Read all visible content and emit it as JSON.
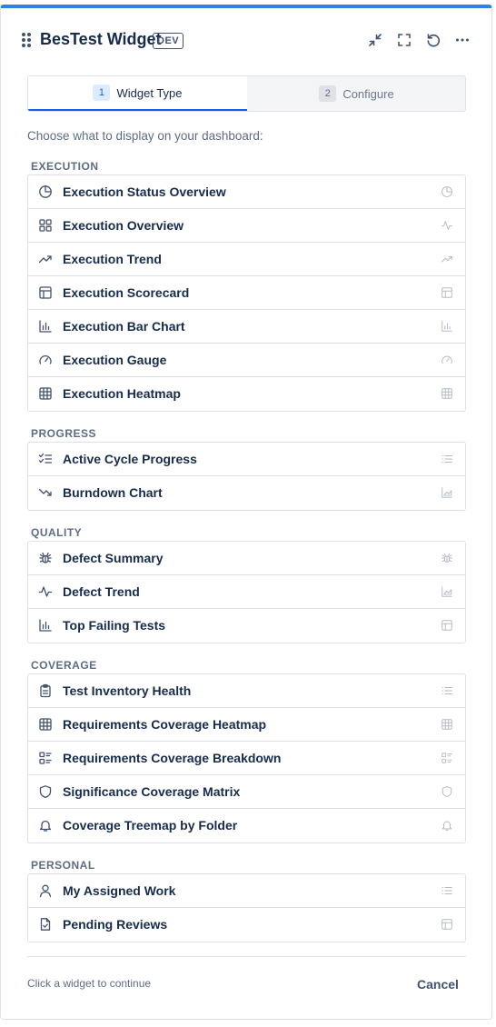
{
  "header": {
    "title": "BesTest Widget",
    "badge": "DEV",
    "actions": [
      "minimize-icon",
      "fullscreen-icon",
      "refresh-icon",
      "more-icon"
    ]
  },
  "stepper": {
    "steps": [
      {
        "number": "1",
        "label": "Widget Type",
        "active": true
      },
      {
        "number": "2",
        "label": "Configure",
        "active": false
      }
    ]
  },
  "intro": "Choose what to display on your dashboard:",
  "sections": [
    {
      "label": "EXECUTION",
      "items": [
        {
          "label": "Execution Status Overview",
          "icon": "pie-icon",
          "trail": "pie-icon"
        },
        {
          "label": "Execution Overview",
          "icon": "grid-icon",
          "trail": "pulse-icon"
        },
        {
          "label": "Execution Trend",
          "icon": "trend-up-icon",
          "trail": "trend-up-icon"
        },
        {
          "label": "Execution Scorecard",
          "icon": "table-icon",
          "trail": "table-icon"
        },
        {
          "label": "Execution Bar Chart",
          "icon": "bar-chart-icon",
          "trail": "bar-chart-icon"
        },
        {
          "label": "Execution Gauge",
          "icon": "gauge-icon",
          "trail": "gauge-icon"
        },
        {
          "label": "Execution Heatmap",
          "icon": "heatmap-icon",
          "trail": "heatmap-icon"
        }
      ]
    },
    {
      "label": "PROGRESS",
      "items": [
        {
          "label": "Active Cycle Progress",
          "icon": "checklist-icon",
          "trail": "list-icon"
        },
        {
          "label": "Burndown Chart",
          "icon": "trend-down-icon",
          "trail": "area-chart-icon"
        }
      ]
    },
    {
      "label": "QUALITY",
      "items": [
        {
          "label": "Defect Summary",
          "icon": "bug-icon",
          "trail": "bug-icon"
        },
        {
          "label": "Defect Trend",
          "icon": "pulse-icon",
          "trail": "area-chart-icon"
        },
        {
          "label": "Top Failing Tests",
          "icon": "bar-chart-icon",
          "trail": "table-icon"
        }
      ]
    },
    {
      "label": "COVERAGE",
      "items": [
        {
          "label": "Test Inventory Health",
          "icon": "clipboard-icon",
          "trail": "list-icon"
        },
        {
          "label": "Requirements Coverage Heatmap",
          "icon": "heatmap-icon",
          "trail": "heatmap-icon"
        },
        {
          "label": "Requirements Coverage Breakdown",
          "icon": "breakdown-icon",
          "trail": "breakdown-icon"
        },
        {
          "label": "Significance Coverage Matrix",
          "icon": "shield-icon",
          "trail": "shield-icon"
        },
        {
          "label": "Coverage Treemap by Folder",
          "icon": "bell-icon",
          "trail": "bell-icon"
        }
      ]
    },
    {
      "label": "PERSONAL",
      "items": [
        {
          "label": "My Assigned Work",
          "icon": "user-icon",
          "trail": "list-icon"
        },
        {
          "label": "Pending Reviews",
          "icon": "file-check-icon",
          "trail": "table-icon"
        }
      ]
    }
  ],
  "footer": {
    "hint": "Click a widget to continue",
    "cancel_label": "Cancel"
  },
  "colors": {
    "accent": "#0c66e4",
    "top_bar": "#2f80ed",
    "text": "#172b4d",
    "muted": "#5e6c84",
    "border": "#dfe1e6"
  }
}
